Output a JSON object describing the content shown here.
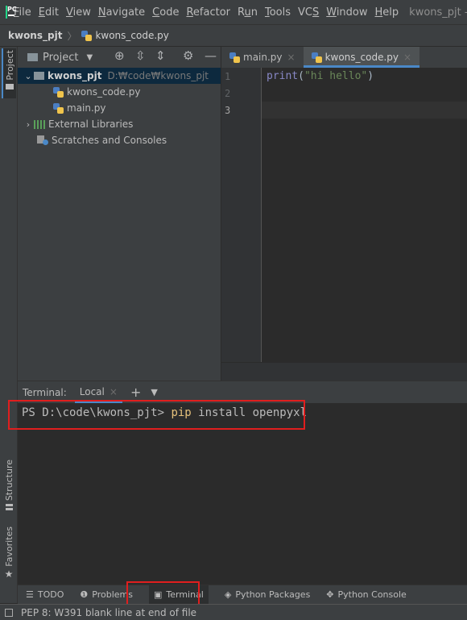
{
  "menubar": {
    "items": [
      {
        "label": "File",
        "mnemonic": "F",
        "rest": "ile"
      },
      {
        "label": "Edit",
        "mnemonic": "E",
        "rest": "dit"
      },
      {
        "label": "View",
        "mnemonic": "V",
        "rest": "iew"
      },
      {
        "label": "Navigate",
        "mnemonic": "N",
        "rest": "avigate"
      },
      {
        "label": "Code",
        "mnemonic": "C",
        "rest": "ode"
      },
      {
        "label": "Refactor",
        "mnemonic": "R",
        "rest": "efactor"
      },
      {
        "label": "Run",
        "mnemonic": "u",
        "pre": "R",
        "rest": "n"
      },
      {
        "label": "Tools",
        "mnemonic": "T",
        "rest": "ools"
      },
      {
        "label": "VCS",
        "mnemonic": "S",
        "pre": "VC",
        "rest": ""
      },
      {
        "label": "Window",
        "mnemonic": "W",
        "rest": "indow"
      },
      {
        "label": "Help",
        "mnemonic": "H",
        "rest": "elp"
      }
    ],
    "window_title": "kwons_pjt -"
  },
  "navbar": {
    "project": "kwons_pjt",
    "separator": "〉",
    "file": "kwons_code.py"
  },
  "left_strip": {
    "project_tab": "Project",
    "structure_tab": "Structure",
    "favorites_tab": "Favorites"
  },
  "project_panel": {
    "view_label": "Project",
    "tree": {
      "root_name": "kwons_pjt",
      "root_path": "D:₩code₩kwons_pjt",
      "files": [
        "kwons_code.py",
        "main.py"
      ],
      "external_libraries": "External Libraries",
      "scratches": "Scratches and Consoles"
    }
  },
  "editor": {
    "tabs": [
      {
        "label": "main.py",
        "active": false
      },
      {
        "label": "kwons_code.py",
        "active": true
      }
    ],
    "line_numbers": [
      "1",
      "2",
      "3"
    ],
    "code": {
      "fn": "print",
      "open": "(",
      "str": "\"hi hello\"",
      "close": ")"
    }
  },
  "terminal": {
    "title": "Terminal:",
    "tab_label": "Local",
    "prompt": "PS D:\\code\\kwons_pjt> ",
    "command": "pip",
    "args": " install openpyxl"
  },
  "bottom_tools": {
    "todo": "TODO",
    "problems": "Problems",
    "terminal": "Terminal",
    "python_packages": "Python Packages",
    "python_console": "Python Console"
  },
  "status_bar": {
    "text": "PEP 8: W391 blank line at end of file"
  },
  "colors": {
    "accent": "#4a88c7",
    "highlight_box": "#e01e1e",
    "command_yellow": "#e5c07b",
    "string_green": "#6a8759",
    "builtin_purple": "#8888c6"
  }
}
